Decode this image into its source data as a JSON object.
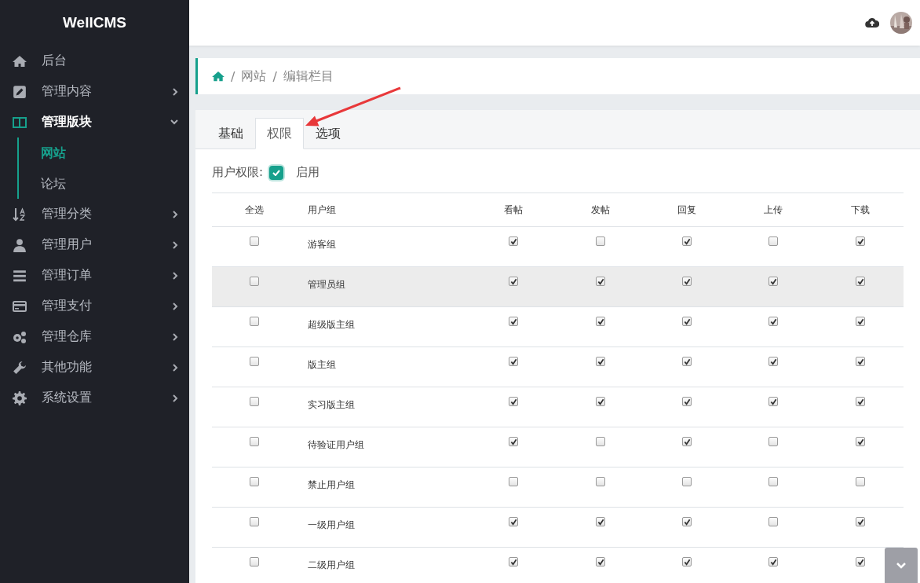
{
  "sidebar": {
    "logo": "WellCMS",
    "items": [
      {
        "label": "后台",
        "selected": false
      },
      {
        "label": "管理内容",
        "selected": false,
        "expanded": false
      },
      {
        "label": "管理版块",
        "selected": true,
        "expanded": true,
        "children": [
          {
            "label": "网站",
            "selected": true
          },
          {
            "label": "论坛",
            "selected": false
          }
        ]
      },
      {
        "label": "管理分类",
        "selected": false,
        "expanded": false
      },
      {
        "label": "管理用户",
        "selected": false,
        "expanded": false
      },
      {
        "label": "管理订单",
        "selected": false,
        "expanded": false
      },
      {
        "label": "管理支付",
        "selected": false,
        "expanded": false
      },
      {
        "label": "管理仓库",
        "selected": false,
        "expanded": false
      },
      {
        "label": "其他功能",
        "selected": false,
        "expanded": false
      },
      {
        "label": "系统设置",
        "selected": false,
        "expanded": false
      }
    ]
  },
  "breadcrumb": {
    "separator": "/",
    "items": [
      "网站",
      "编辑栏目"
    ]
  },
  "tabs": [
    {
      "label": "基础",
      "selected": false
    },
    {
      "label": "权限",
      "selected": true
    },
    {
      "label": "选项",
      "selected": false
    }
  ],
  "user_permission": {
    "label": "用户权限:",
    "option": "启用",
    "checked": true
  },
  "table": {
    "columns": [
      "全选",
      "用户组",
      "看帖",
      "发帖",
      "回复",
      "上传",
      "下载"
    ],
    "rows": [
      {
        "select": false,
        "group": "游客组",
        "highlighted": false,
        "permissions": [
          true,
          false,
          true,
          false,
          true
        ]
      },
      {
        "select": false,
        "group": "管理员组",
        "highlighted": true,
        "permissions": [
          true,
          true,
          true,
          true,
          true
        ]
      },
      {
        "select": false,
        "group": "超级版主组",
        "highlighted": false,
        "permissions": [
          true,
          true,
          true,
          true,
          true
        ]
      },
      {
        "select": false,
        "group": "版主组",
        "highlighted": false,
        "permissions": [
          true,
          true,
          true,
          true,
          true
        ]
      },
      {
        "select": false,
        "group": "实习版主组",
        "highlighted": false,
        "permissions": [
          true,
          true,
          true,
          true,
          true
        ]
      },
      {
        "select": false,
        "group": "待验证用户组",
        "highlighted": false,
        "permissions": [
          true,
          false,
          true,
          false,
          true
        ]
      },
      {
        "select": false,
        "group": "禁止用户组",
        "highlighted": false,
        "permissions": [
          false,
          false,
          false,
          false,
          false
        ]
      },
      {
        "select": false,
        "group": "一级用户组",
        "highlighted": false,
        "permissions": [
          true,
          true,
          true,
          false,
          true
        ]
      },
      {
        "select": false,
        "group": "二级用户组",
        "highlighted": false,
        "permissions": [
          true,
          true,
          true,
          true,
          true
        ]
      }
    ]
  }
}
